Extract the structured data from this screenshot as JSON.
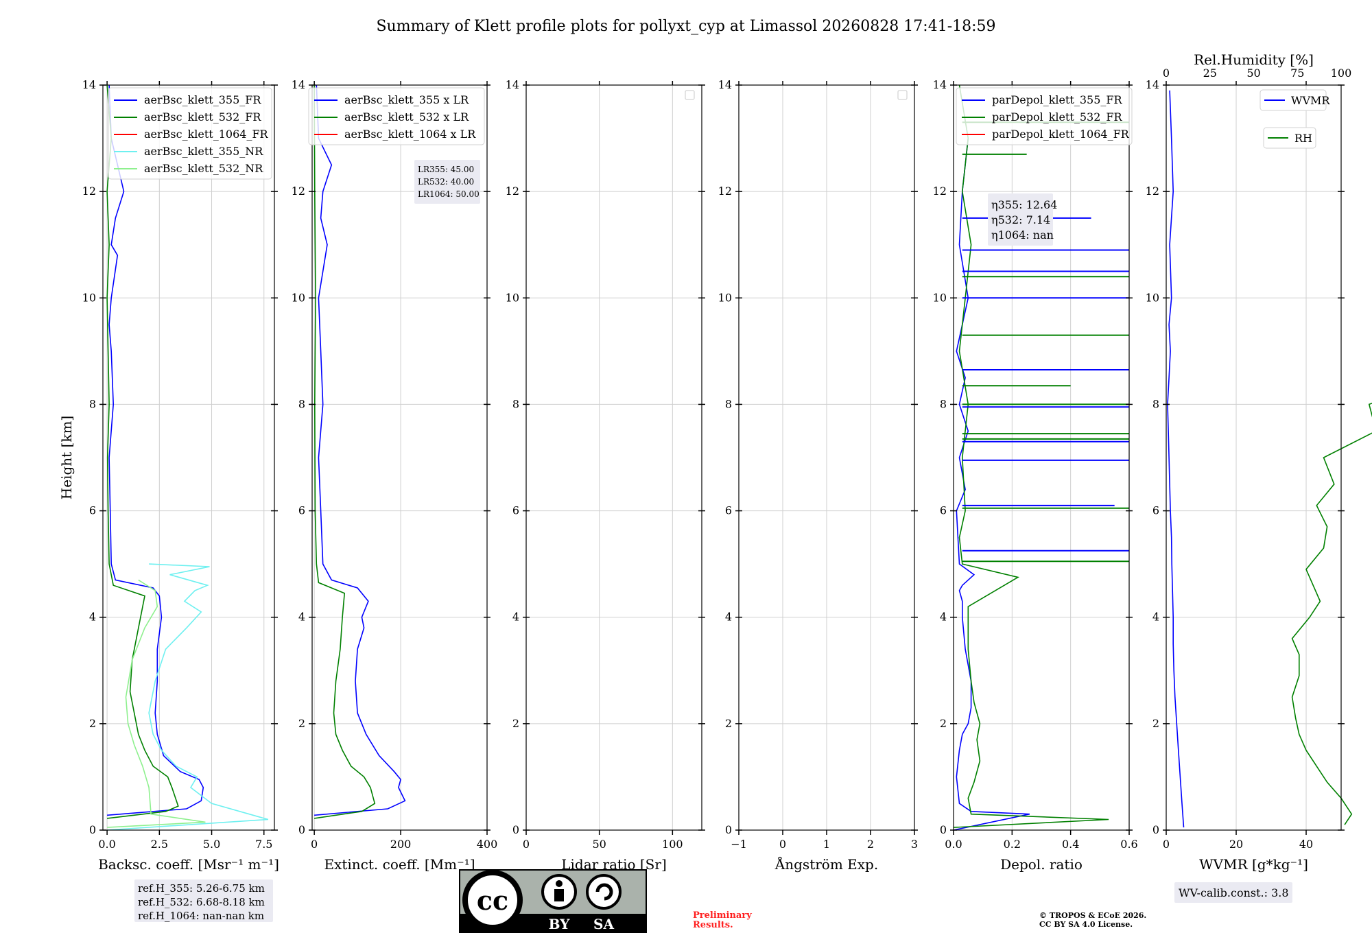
{
  "title": "Summary of Klett profile plots for pollyxt_cyp at Limassol 20260828 17:41-18:59",
  "colors": {
    "c355": "#0000ff",
    "c532": "#008000",
    "c1064": "#ff0000",
    "c355nr": "#6ef0f0",
    "c532nr": "#8ef08e"
  },
  "chart_data": [
    {
      "type": "line",
      "xlabel": "Backsc. coeff. [Msr⁻¹ m⁻¹]",
      "ylabel": "Height [km]",
      "xlim": [
        -0.2,
        8.0
      ],
      "ylim": [
        0,
        14
      ],
      "xticks": [
        "0.0",
        "2.5",
        "5.0",
        "7.5"
      ],
      "xtick_values": [
        0,
        2.5,
        5,
        7.5
      ],
      "yticks": [
        "0",
        "2",
        "4",
        "6",
        "8",
        "10",
        "12",
        "14"
      ],
      "legend": "top-right",
      "series": [
        {
          "name": "aerBsc_klett_355_FR",
          "color": "#0000ff",
          "x": [
            0,
            3.8,
            4.5,
            4.6,
            4.4,
            3.5,
            2.7,
            2.4,
            2.3,
            2.4,
            2.4,
            2.6,
            2.5,
            2.2,
            0.4,
            0.2,
            0.15,
            0.1,
            0.3,
            0.2,
            0.1,
            0.2,
            0.5,
            0.2,
            0.4,
            0.8,
            0.2,
            0.1
          ],
          "y": [
            0.28,
            0.4,
            0.55,
            0.8,
            0.95,
            1.1,
            1.4,
            1.8,
            2.2,
            2.8,
            3.4,
            4.0,
            4.4,
            4.55,
            4.7,
            5.0,
            6.0,
            7.0,
            8.0,
            9.0,
            9.5,
            10.0,
            10.8,
            11.0,
            11.5,
            12.0,
            13.0,
            14.0
          ]
        },
        {
          "name": "aerBsc_klett_532_FR",
          "color": "#008000",
          "x": [
            0,
            2.8,
            3.4,
            3.1,
            2.9,
            2.2,
            1.8,
            1.5,
            1.3,
            1.1,
            1.2,
            1.6,
            1.8,
            0.3,
            0.1,
            0.05,
            0.02,
            0.1,
            0.05,
            0.0,
            0.1,
            0.0,
            0.2,
            0.0
          ],
          "y": [
            0.22,
            0.35,
            0.45,
            0.8,
            1.0,
            1.2,
            1.5,
            1.8,
            2.2,
            2.6,
            3.2,
            4.0,
            4.4,
            4.6,
            5.0,
            6.0,
            7.0,
            8.0,
            9.0,
            10.0,
            11.0,
            12.0,
            13.0,
            14.0
          ]
        },
        {
          "name": "aerBsc_klett_1064_FR",
          "color": "#ff0000",
          "x": [],
          "y": []
        },
        {
          "name": "aerBsc_klett_355_NR",
          "color": "#6ef0f0",
          "x": [
            0,
            7.7,
            5.0,
            4.0,
            4.3,
            3.3,
            2.6,
            2.2,
            2.0,
            2.3,
            2.8,
            3.8,
            4.5,
            3.7,
            4.2,
            4.8,
            3.0,
            4.9,
            2.0
          ],
          "y": [
            0.0,
            0.2,
            0.5,
            0.8,
            1.0,
            1.2,
            1.5,
            1.8,
            2.2,
            2.8,
            3.4,
            3.8,
            4.1,
            4.3,
            4.5,
            4.6,
            4.8,
            4.95,
            5.0
          ]
        },
        {
          "name": "aerBsc_klett_532_NR",
          "color": "#8ef08e",
          "x": [
            0,
            4.7,
            2.1,
            2.0,
            1.7,
            1.3,
            1.0,
            0.9,
            1.2,
            1.8,
            2.4,
            2.3,
            1.5
          ],
          "y": [
            0.05,
            0.15,
            0.3,
            0.8,
            1.2,
            1.6,
            2.0,
            2.5,
            3.2,
            3.8,
            4.2,
            4.5,
            4.7
          ]
        }
      ]
    },
    {
      "type": "line",
      "xlabel": "Extinct. coeff. [Mm⁻¹]",
      "xlim": [
        -5,
        400
      ],
      "ylim": [
        0,
        14
      ],
      "xticks": [
        "0",
        "200",
        "400"
      ],
      "xtick_values": [
        0,
        200,
        400
      ],
      "yticks": [
        "0",
        "2",
        "4",
        "6",
        "8",
        "10",
        "12",
        "14"
      ],
      "legend": "top-right",
      "series": [
        {
          "name": "aerBsc_klett_355 x LR",
          "color": "#0000ff",
          "x": [
            0,
            170,
            210,
            195,
            200,
            185,
            150,
            120,
            100,
            95,
            100,
            115,
            110,
            125,
            100,
            40,
            20,
            15,
            10,
            20,
            15,
            10,
            30,
            15,
            20,
            40,
            10,
            5
          ],
          "y": [
            0.28,
            0.4,
            0.55,
            0.8,
            0.95,
            1.1,
            1.4,
            1.8,
            2.2,
            2.8,
            3.4,
            3.8,
            4.0,
            4.3,
            4.55,
            4.7,
            5.0,
            6.0,
            7.0,
            8.0,
            9.0,
            10.0,
            11.0,
            11.5,
            12.0,
            12.5,
            13.0,
            14.0
          ]
        },
        {
          "name": "aerBsc_klett_532 x LR",
          "color": "#008000",
          "x": [
            0,
            110,
            140,
            130,
            115,
            85,
            65,
            50,
            45,
            50,
            60,
            65,
            70,
            10,
            5,
            2,
            1,
            3,
            1,
            0
          ],
          "y": [
            0.22,
            0.35,
            0.5,
            0.8,
            1.0,
            1.2,
            1.5,
            1.8,
            2.2,
            2.8,
            3.4,
            4.0,
            4.45,
            4.65,
            5.0,
            6.0,
            8.0,
            10.0,
            12.0,
            14.0
          ]
        },
        {
          "name": "aerBsc_klett_1064 x LR",
          "color": "#ff0000",
          "x": [],
          "y": []
        }
      ],
      "annotation": [
        "LR355: 45.00",
        "LR532: 40.00",
        "LR1064: 50.00"
      ]
    },
    {
      "type": "line",
      "xlabel": "Lidar ratio [Sr]",
      "xlim": [
        0,
        120
      ],
      "ylim": [
        0,
        14
      ],
      "xticks": [
        "0",
        "50",
        "100"
      ],
      "xtick_values": [
        0,
        50,
        100
      ],
      "yticks": [
        "0",
        "2",
        "4",
        "6",
        "8",
        "10",
        "12",
        "14"
      ],
      "legend": "top-right",
      "series": []
    },
    {
      "type": "line",
      "xlabel": "Ångström Exp.",
      "xlim": [
        -1,
        3
      ],
      "ylim": [
        0,
        14
      ],
      "xticks": [
        "−1",
        "0",
        "1",
        "2",
        "3"
      ],
      "xtick_values": [
        -1,
        0,
        1,
        2,
        3
      ],
      "yticks": [
        "0",
        "2",
        "4",
        "6",
        "8",
        "10",
        "12",
        "14"
      ],
      "legend": "top-right",
      "series": []
    },
    {
      "type": "line",
      "xlabel": "Depol. ratio",
      "xlim": [
        0,
        0.6
      ],
      "ylim": [
        0,
        14
      ],
      "xticks": [
        "0.0",
        "0.2",
        "0.4",
        "0.6"
      ],
      "xtick_values": [
        0,
        0.2,
        0.4,
        0.6
      ],
      "yticks": [
        "0",
        "2",
        "4",
        "6",
        "8",
        "10",
        "12",
        "14"
      ],
      "legend": "top-left",
      "series": [
        {
          "name": "parDepol_klett_355_FR",
          "color": "#0000ff",
          "x": [
            0.0,
            0.26,
            0.06,
            0.02,
            0.01,
            0.02,
            0.03,
            0.05,
            0.06,
            0.06,
            0.04,
            0.03,
            0.03,
            0.02,
            0.03,
            0.07,
            0.02,
            0.01,
            0.04,
            0.02,
            0.05,
            0.02,
            0.04,
            0.01,
            0.05,
            0.02,
            0.03,
            0.05
          ],
          "y": [
            0.0,
            0.3,
            0.35,
            0.5,
            1.0,
            1.5,
            1.8,
            2.0,
            2.3,
            2.8,
            3.4,
            4.0,
            4.3,
            4.5,
            4.6,
            4.8,
            5.0,
            6.0,
            6.4,
            7.0,
            7.5,
            8.0,
            8.5,
            9.0,
            10.0,
            11.0,
            12.0,
            13.0
          ]
        },
        {
          "name": "parDepol_klett_532_FR",
          "color": "#008000",
          "x": [
            0.0,
            0.53,
            0.06,
            0.05,
            0.07,
            0.09,
            0.08,
            0.09,
            0.07,
            0.06,
            0.05,
            0.05,
            0.22,
            0.03,
            0.02,
            0.04,
            0.03,
            0.05,
            0.02,
            0.04,
            0.06,
            0.03,
            0.05,
            0.02
          ],
          "y": [
            0.05,
            0.2,
            0.3,
            0.6,
            0.9,
            1.3,
            1.7,
            2.0,
            2.4,
            2.8,
            3.4,
            4.2,
            4.75,
            5.0,
            5.5,
            6.0,
            7.0,
            8.0,
            9.0,
            10.0,
            11.0,
            12.0,
            13.0,
            14.0
          ]
        },
        {
          "name": "parDepol_klett_1064_FR",
          "color": "#ff0000",
          "x": [],
          "y": []
        }
      ],
      "spikes_355": [
        [
          5.25,
          0.6
        ],
        [
          6.1,
          0.55
        ],
        [
          6.95,
          0.6
        ],
        [
          7.3,
          0.6
        ],
        [
          7.95,
          0.6
        ],
        [
          8.65,
          0.6
        ],
        [
          10.0,
          0.6
        ],
        [
          10.5,
          0.6
        ],
        [
          10.9,
          0.6
        ],
        [
          11.5,
          0.47
        ]
      ],
      "spikes_532": [
        [
          5.05,
          0.6
        ],
        [
          6.05,
          0.6
        ],
        [
          7.35,
          0.6
        ],
        [
          7.45,
          0.6
        ],
        [
          8.0,
          0.6
        ],
        [
          9.3,
          0.6
        ],
        [
          10.4,
          0.6
        ],
        [
          13.3,
          0.6
        ],
        [
          12.7,
          0.25
        ],
        [
          8.35,
          0.4
        ]
      ],
      "annotation": [
        "η355: 12.64",
        "η532: 7.14",
        "η1064: nan"
      ]
    },
    {
      "type": "line",
      "xlabel": "WVMR [g*kg⁻¹]",
      "xlabel2": "Rel.Humidity [%]",
      "xlim": [
        0,
        50
      ],
      "xlim2": [
        0,
        100
      ],
      "ylim": [
        0,
        14
      ],
      "xticks": [
        "0",
        "20",
        "40"
      ],
      "xtick_values": [
        0,
        20,
        40
      ],
      "xticks2": [
        "0",
        "25",
        "50",
        "75",
        "100"
      ],
      "xtick_values2": [
        0,
        25,
        50,
        75,
        100
      ],
      "yticks": [
        "0",
        "2",
        "4",
        "6",
        "8",
        "10",
        "12",
        "14"
      ],
      "series": [
        {
          "name": "WVMR",
          "color": "#0000ff",
          "x": [
            5,
            4.5,
            4,
            3.5,
            3,
            2.5,
            2.2,
            2.0,
            2.0,
            1.8,
            1.6,
            1.5,
            1.2,
            1.0,
            0.8,
            0.6,
            0.4,
            0.8,
            1.2,
            0.8,
            1.5,
            1.0,
            2.0,
            1.5,
            1.0
          ],
          "y": [
            0.05,
            0.5,
            1.0,
            1.5,
            2.0,
            2.5,
            3.0,
            3.5,
            4.0,
            4.5,
            5.0,
            5.5,
            6.0,
            6.5,
            7.0,
            7.5,
            8.0,
            8.5,
            9.0,
            9.5,
            10.0,
            11.0,
            12.0,
            13.0,
            13.9
          ]
        },
        {
          "name": "RH",
          "color": "#008000",
          "x": [
            51,
            53,
            50,
            46,
            43,
            40,
            38,
            37,
            36,
            38,
            38,
            36,
            41,
            44,
            42,
            40,
            45,
            46,
            43,
            48,
            45,
            60,
            58,
            70
          ],
          "y": [
            0.1,
            0.3,
            0.6,
            0.9,
            1.2,
            1.5,
            1.8,
            2.1,
            2.5,
            2.9,
            3.3,
            3.6,
            4.0,
            4.3,
            4.6,
            4.9,
            5.3,
            5.7,
            6.1,
            6.5,
            7.0,
            7.5,
            8.0,
            8.3
          ]
        }
      ],
      "annotation": "WV-calib.const.: 3.8"
    }
  ],
  "refs": [
    "ref.H_355: 5.26-6.75 km",
    "ref.H_532: 6.68-8.18 km",
    "ref.H_1064: nan-nan km"
  ],
  "license_badge": {
    "top": "cc",
    "by": "BY",
    "sa": "SA"
  },
  "preliminary": [
    "Preliminary",
    "Results."
  ],
  "copyright": [
    "© TROPOS & ECoE 2026.",
    "CC BY SA 4.0 License."
  ]
}
